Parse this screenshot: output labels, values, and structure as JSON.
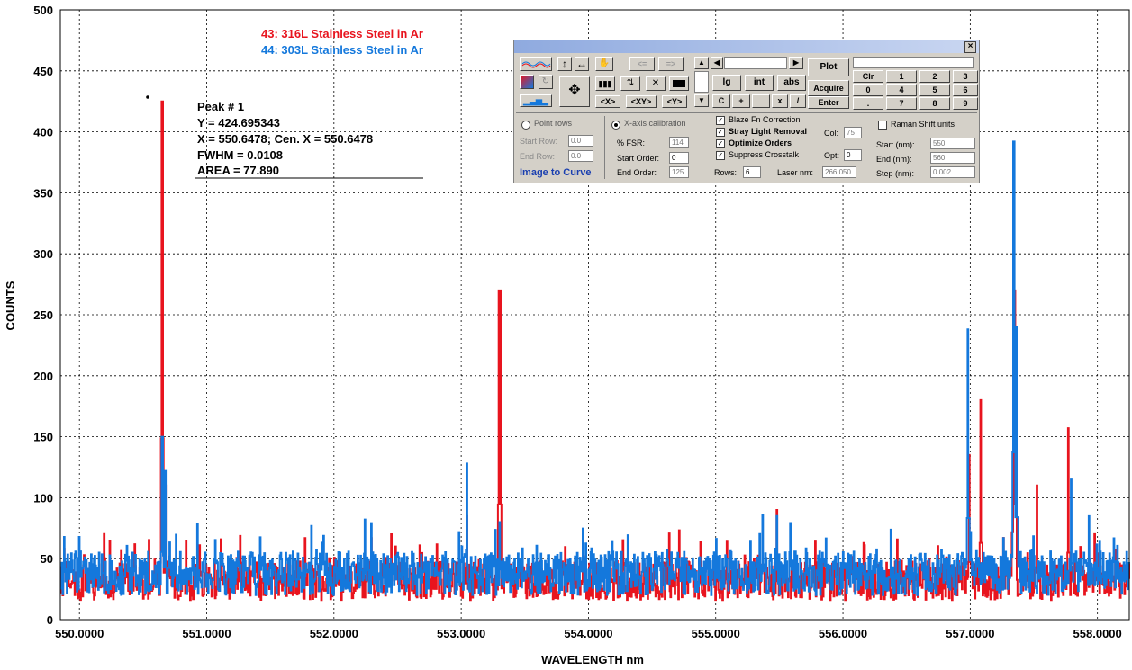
{
  "chart_data": {
    "type": "line",
    "xlabel": "WAVELENGTH nm",
    "ylabel": "COUNTS",
    "xlim": [
      549.85,
      558.25
    ],
    "ylim": [
      0,
      500
    ],
    "xticks": [
      550.0,
      551.0,
      552.0,
      553.0,
      554.0,
      555.0,
      556.0,
      557.0,
      558.0
    ],
    "xtick_labels": [
      "550.0000",
      "551.0000",
      "552.0000",
      "553.0000",
      "554.0000",
      "555.0000",
      "556.0000",
      "557.0000",
      "558.0000"
    ],
    "yticks": [
      0,
      50,
      100,
      150,
      200,
      250,
      300,
      350,
      400,
      450,
      500
    ],
    "ytick_labels": [
      "0",
      "50",
      "100",
      "150",
      "200",
      "250",
      "300",
      "350",
      "400",
      "450",
      "500"
    ],
    "grid": true,
    "legend_position": "top-left",
    "series": [
      {
        "name": "43: 316L Stainless Steel in Ar",
        "color": "#e8141e",
        "baseline": 32,
        "noise": 16,
        "peaks": [
          {
            "x": 550.648,
            "y": 425
          },
          {
            "x": 550.67,
            "y": 110
          },
          {
            "x": 553.04,
            "y": 85
          },
          {
            "x": 553.295,
            "y": 270
          },
          {
            "x": 553.305,
            "y": 270
          },
          {
            "x": 555.48,
            "y": 90
          },
          {
            "x": 556.99,
            "y": 135
          },
          {
            "x": 557.08,
            "y": 180
          },
          {
            "x": 557.335,
            "y": 205
          },
          {
            "x": 557.35,
            "y": 270
          },
          {
            "x": 557.52,
            "y": 110
          },
          {
            "x": 557.77,
            "y": 157
          }
        ]
      },
      {
        "name": "44: 303L Stainless Steel in Ar",
        "color": "#1478dc",
        "baseline": 38,
        "noise": 18,
        "peaks": [
          {
            "x": 550.648,
            "y": 150
          },
          {
            "x": 550.67,
            "y": 122
          },
          {
            "x": 553.04,
            "y": 128
          },
          {
            "x": 553.3,
            "y": 80
          },
          {
            "x": 555.48,
            "y": 85
          },
          {
            "x": 556.98,
            "y": 238
          },
          {
            "x": 557.34,
            "y": 392
          },
          {
            "x": 557.36,
            "y": 240
          },
          {
            "x": 557.79,
            "y": 115
          }
        ]
      }
    ],
    "peak_annotation": {
      "lines": [
        "Peak # 1",
        "Y = 424.695343",
        "X = 550.6478;  Cen. X = 550.6478",
        "FWHM = 0.0108",
        "AREA = 77.890"
      ]
    }
  },
  "panel": {
    "close": "×",
    "top_field": "",
    "plot": "Plot",
    "acquire": "Acquire",
    "enter": "Enter",
    "lg": "lg",
    "int": "int",
    "abs": "abs",
    "c": "C",
    "plus": "+",
    "x": "x",
    "div": "/",
    "back": "<=",
    "fwd": "=>",
    "zoom_x": "<X>",
    "zoom_xy": "<XY>",
    "zoom_y": "<Y>",
    "keys": [
      "Clr",
      "1",
      "2",
      "3",
      "0",
      "4",
      "5",
      "6",
      ".",
      "7",
      "8",
      "9"
    ],
    "point_rows": "Point rows",
    "xaxis_calibration": "X-axis calibration",
    "start_row": "Start Row:",
    "start_row_val": "0.0",
    "end_row": "End Row:",
    "end_row_val": "0.0",
    "image_to_curve": "Image to Curve",
    "pct_fsr": "% FSR:",
    "pct_fsr_val": "114",
    "start_order": "Start Order:",
    "start_order_val": "0",
    "end_order": "End Order:",
    "end_order_val": "125",
    "blaze": "Blaze Fn Correction",
    "stray": "Stray Light Removal",
    "optimize": "Optimize Orders",
    "suppress": "Suppress Crosstalk",
    "col": "Col:",
    "col_val": "75",
    "opt": "Opt:",
    "opt_val": "0",
    "rows": "Rows:",
    "rows_val": "6",
    "laser": "Laser nm:",
    "laser_val": "266.050",
    "raman": "Raman Shift units",
    "start_nm": "Start (nm):",
    "start_nm_val": "550",
    "end_nm": "End (nm):",
    "end_nm_val": "560",
    "step_nm": "Step (nm):",
    "step_nm_val": "0.002"
  }
}
